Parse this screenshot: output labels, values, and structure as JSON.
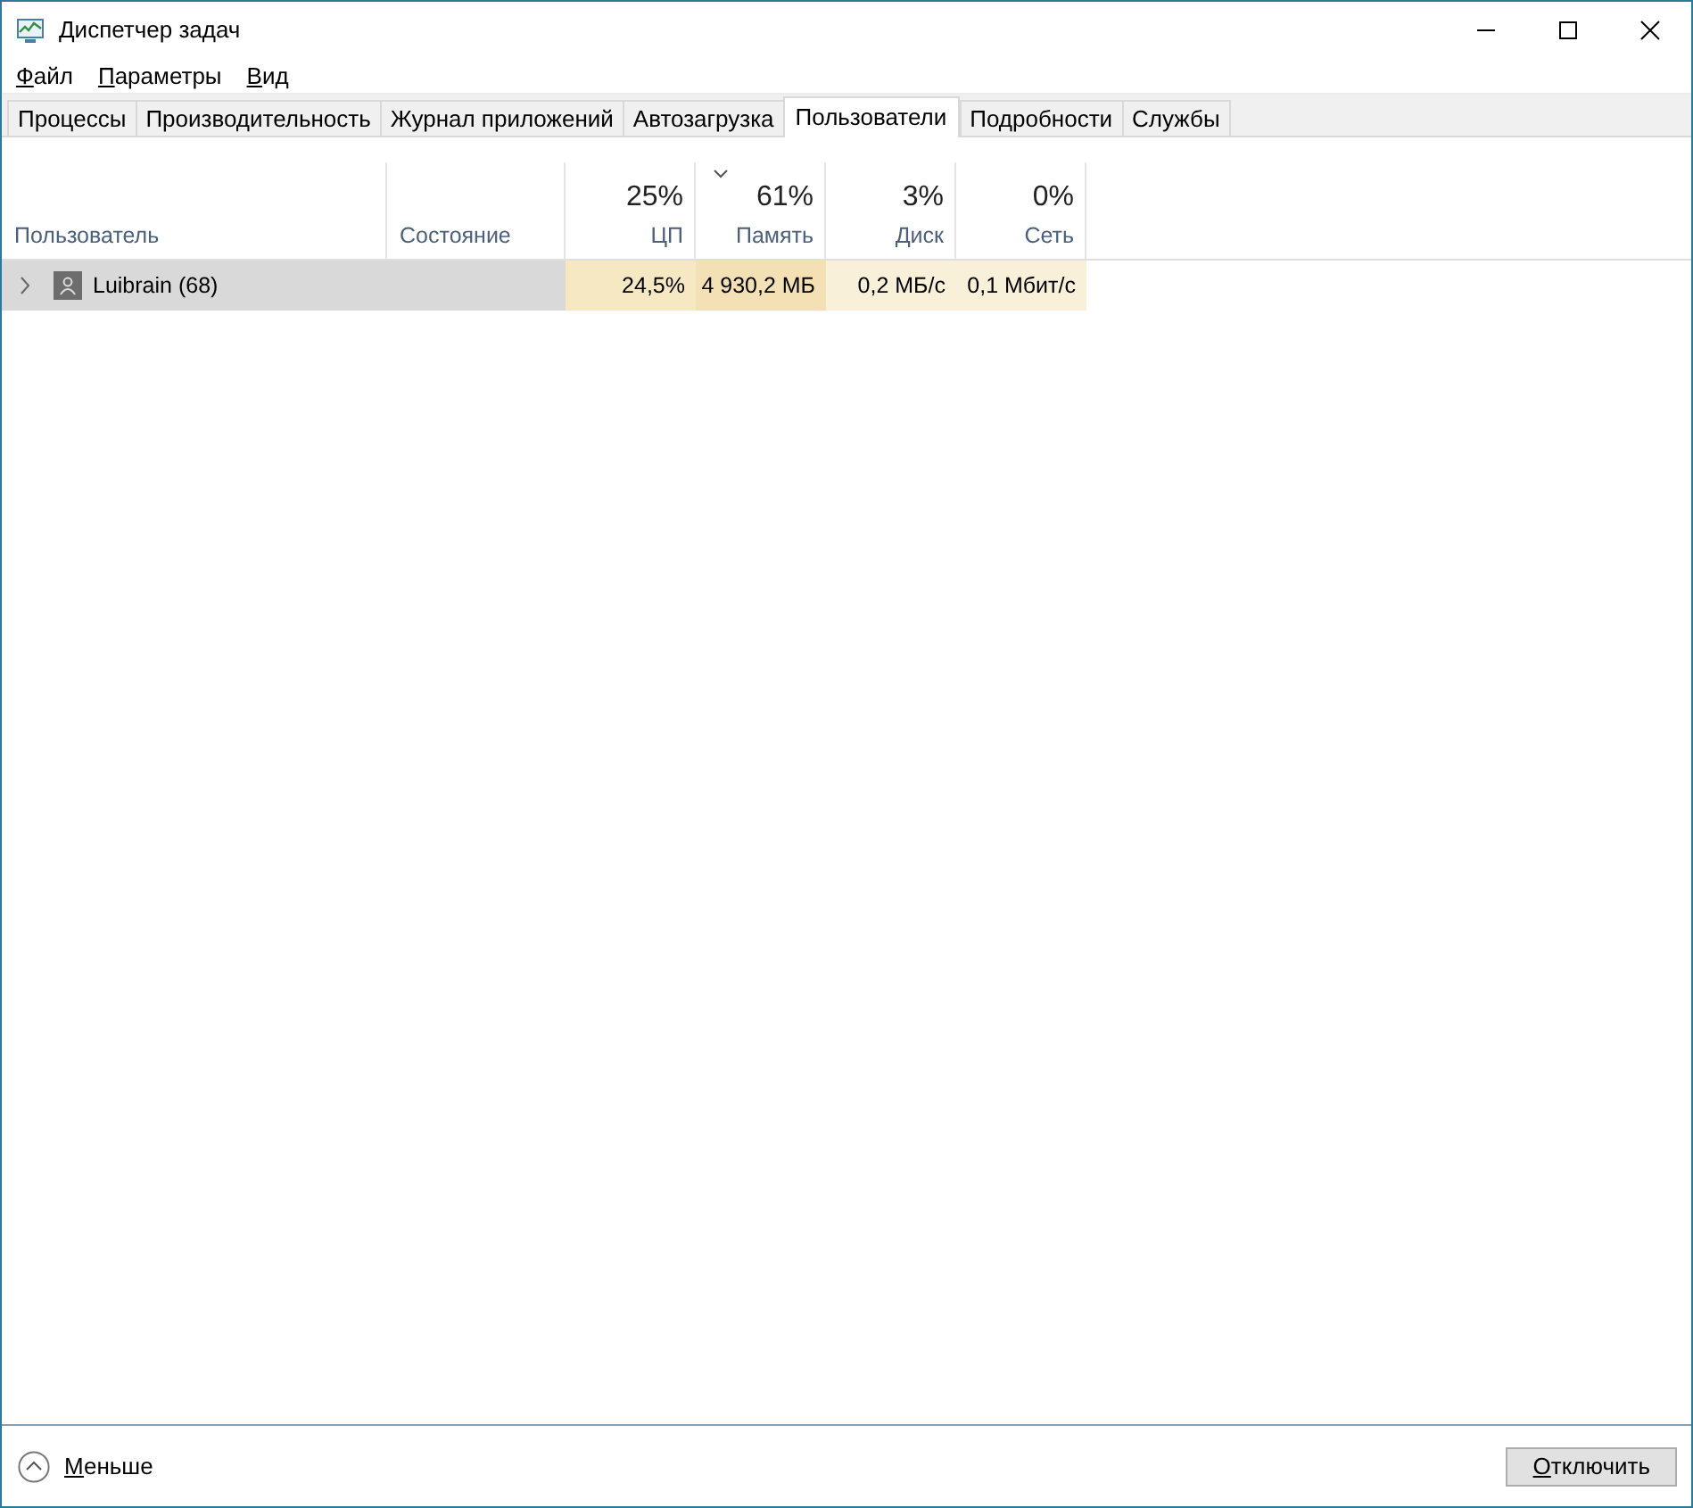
{
  "window": {
    "title": "Диспетчер задач"
  },
  "menu": [
    "Файл",
    "Параметры",
    "Вид"
  ],
  "tabs": [
    {
      "label": "Процессы",
      "selected": false
    },
    {
      "label": "Производительность",
      "selected": false
    },
    {
      "label": "Журнал приложений",
      "selected": false
    },
    {
      "label": "Автозагрузка",
      "selected": false
    },
    {
      "label": "Пользователи",
      "selected": true
    },
    {
      "label": "Подробности",
      "selected": false
    },
    {
      "label": "Службы",
      "selected": false
    }
  ],
  "table": {
    "columns": [
      {
        "label": "Пользователь",
        "sorted": false
      },
      {
        "label": "Состояние",
        "sorted": false
      },
      {
        "usage": "25%",
        "label": "ЦП",
        "sorted": false
      },
      {
        "usage": "61%",
        "label": "Память",
        "sorted": true
      },
      {
        "usage": "3%",
        "label": "Диск",
        "sorted": false
      },
      {
        "usage": "0%",
        "label": "Сеть",
        "sorted": false
      }
    ],
    "rows": [
      {
        "expanded": false,
        "selected": true,
        "cells": [
          {
            "value": "Luibrain (68)"
          },
          {},
          {
            "value": "24,5%",
            "color": "#f7e8c4"
          },
          {
            "value": "4 930,2 МБ",
            "color": "#f3e1b5"
          },
          {
            "value": "0,2 МБ/с",
            "color": "#f9f0da"
          },
          {
            "value": "0,1 Мбит/с",
            "color": "#f9f0da"
          }
        ]
      }
    ]
  },
  "footer": {
    "toggle": "Меньше",
    "button": "Отключить"
  }
}
